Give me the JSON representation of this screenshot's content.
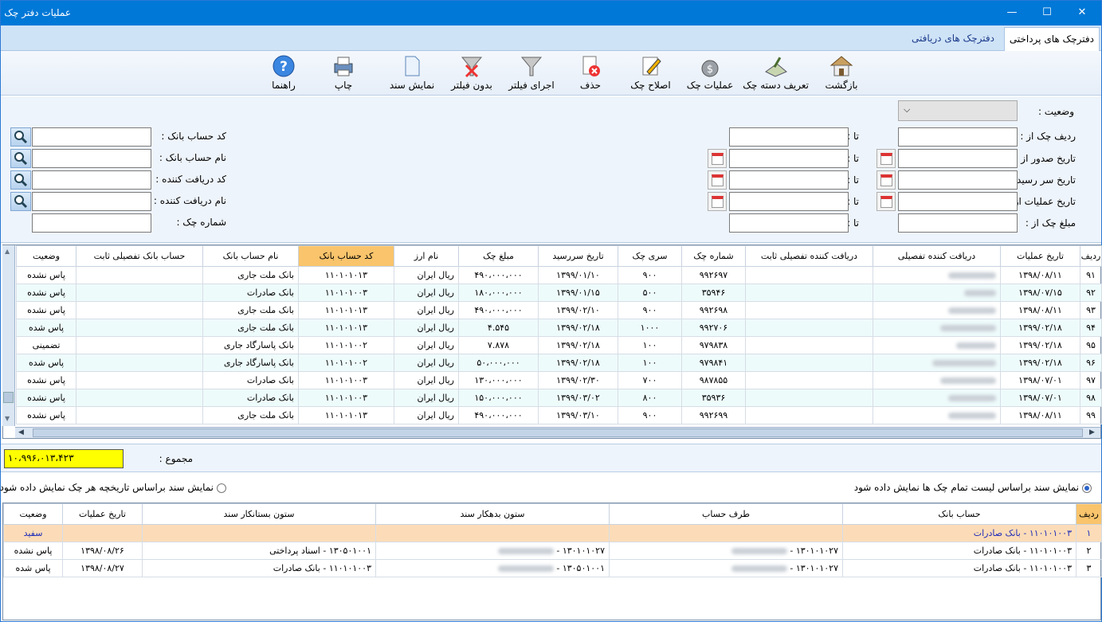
{
  "window": {
    "title": "عملیات دفتر چک",
    "minimize": "—",
    "maximize": "☐",
    "close": "✕"
  },
  "tabs": [
    {
      "label": "دفترچک های پرداختی",
      "active": true
    },
    {
      "label": "دفترچک های دریافتی",
      "active": false
    }
  ],
  "toolbar": [
    {
      "label": "بازگشت",
      "icon": "home-icon"
    },
    {
      "label": "تعریف دسته چک",
      "icon": "checkbook-icon"
    },
    {
      "label": "عملیات چک",
      "icon": "money-bag-icon"
    },
    {
      "label": "اصلاح چک",
      "icon": "edit-icon"
    },
    {
      "label": "حذف",
      "icon": "delete-icon"
    },
    {
      "label": "اجرای فیلتر",
      "icon": "filter-icon"
    },
    {
      "label": "بدون فیلتر",
      "icon": "clear-filter-icon"
    },
    {
      "label": "نمایش سند",
      "icon": "document-icon"
    },
    {
      "label": "چاپ",
      "icon": "printer-icon"
    },
    {
      "label": "راهنما",
      "icon": "help-icon"
    }
  ],
  "filters": {
    "status_label": "وضعیت :",
    "check_row_from": "ردیف چک از :",
    "issue_date_from": "تاریخ صدور از :",
    "due_date_from": "تاریخ سر رسید از :",
    "op_date_from": "تاریخ عملیات از :",
    "amount_from": "مبلغ چک از :",
    "to": "تا :",
    "bank_account_code": "کد حساب بانک :",
    "bank_account_name": "نام حساب بانک :",
    "receiver_code": "کد دریافت کننده :",
    "receiver_name": "نام دریافت کننده :",
    "check_number": "شماره چک :"
  },
  "grid": {
    "columns": [
      "ردیف",
      "تاریخ عملیات",
      "دریافت کننده تفصیلی",
      "دریافت کننده تفصیلی ثابت",
      "شماره چک",
      "سری چک",
      "تاریخ سررسید",
      "مبلغ چک",
      "نام ارز",
      "کد حساب بانک",
      "نام حساب بانک",
      "حساب بانک تفصیلی ثابت",
      "وضعیت"
    ],
    "rows": [
      {
        "row": "۹۱",
        "op_date": "۱۳۹۸/۰۸/۱۱",
        "check_no": "۹۹۲۶۹۷",
        "series": "۹۰۰",
        "due": "۱۳۹۹/۰۱/۱۰",
        "amount": "۴۹۰،۰۰۰،۰۰۰",
        "currency": "ریال ایران",
        "bank_code": "۱۱۰۱۰۱۰۱۳",
        "bank_name": "بانک ملت جاری",
        "status": "پاس نشده"
      },
      {
        "row": "۹۲",
        "op_date": "۱۳۹۸/۰۷/۱۵",
        "check_no": "۳۵۹۴۶",
        "series": "۵۰۰",
        "due": "۱۳۹۹/۰۱/۱۵",
        "amount": "۱۸۰،۰۰۰،۰۰۰",
        "currency": "ریال ایران",
        "bank_code": "۱۱۰۱۰۱۰۰۳",
        "bank_name": "بانک صادرات",
        "status": "پاس نشده"
      },
      {
        "row": "۹۳",
        "op_date": "۱۳۹۸/۰۸/۱۱",
        "check_no": "۹۹۲۶۹۸",
        "series": "۹۰۰",
        "due": "۱۳۹۹/۰۲/۱۰",
        "amount": "۴۹۰،۰۰۰،۰۰۰",
        "currency": "ریال ایران",
        "bank_code": "۱۱۰۱۰۱۰۱۳",
        "bank_name": "بانک ملت جاری",
        "status": "پاس نشده"
      },
      {
        "row": "۹۴",
        "op_date": "۱۳۹۹/۰۲/۱۸",
        "check_no": "۹۹۲۷۰۶",
        "series": "۱۰۰۰",
        "due": "۱۳۹۹/۰۲/۱۸",
        "amount": "۴.۵۴۵",
        "currency": "ریال ایران",
        "bank_code": "۱۱۰۱۰۱۰۱۳",
        "bank_name": "بانک ملت جاری",
        "status": "پاس شده"
      },
      {
        "row": "۹۵",
        "op_date": "۱۳۹۹/۰۲/۱۸",
        "check_no": "۹۷۹۸۳۸",
        "series": "۱۰۰",
        "due": "۱۳۹۹/۰۲/۱۸",
        "amount": "۷.۸۷۸",
        "currency": "ریال ایران",
        "bank_code": "۱۱۰۱۰۱۰۰۲",
        "bank_name": "بانک پاسارگاد جاری",
        "status": "تضمینی"
      },
      {
        "row": "۹۶",
        "op_date": "۱۳۹۹/۰۲/۱۸",
        "check_no": "۹۷۹۸۴۱",
        "series": "۱۰۰",
        "due": "۱۳۹۹/۰۲/۱۸",
        "amount": "۵۰،۰۰۰،۰۰۰",
        "currency": "ریال ایران",
        "bank_code": "۱۱۰۱۰۱۰۰۲",
        "bank_name": "بانک پاسارگاد جاری",
        "status": "پاس شده"
      },
      {
        "row": "۹۷",
        "op_date": "۱۳۹۸/۰۷/۰۱",
        "check_no": "۹۸۷۸۵۵",
        "series": "۷۰۰",
        "due": "۱۳۹۹/۰۲/۳۰",
        "amount": "۱۳۰،۰۰۰،۰۰۰",
        "currency": "ریال ایران",
        "bank_code": "۱۱۰۱۰۱۰۰۳",
        "bank_name": "بانک صادرات",
        "status": "پاس نشده"
      },
      {
        "row": "۹۸",
        "op_date": "۱۳۹۸/۰۷/۰۱",
        "check_no": "۳۵۹۳۶",
        "series": "۸۰۰",
        "due": "۱۳۹۹/۰۳/۰۲",
        "amount": "۱۵۰،۰۰۰،۰۰۰",
        "currency": "ریال ایران",
        "bank_code": "۱۱۰۱۰۱۰۰۳",
        "bank_name": "بانک صادرات",
        "status": "پاس نشده"
      },
      {
        "row": "۹۹",
        "op_date": "۱۳۹۸/۰۸/۱۱",
        "check_no": "۹۹۲۶۹۹",
        "series": "۹۰۰",
        "due": "۱۳۹۹/۰۳/۱۰",
        "amount": "۴۹۰،۰۰۰،۰۰۰",
        "currency": "ریال ایران",
        "bank_code": "۱۱۰۱۰۱۰۱۳",
        "bank_name": "بانک ملت جاری",
        "status": "پاس نشده"
      }
    ]
  },
  "summary": {
    "label": "مجموع :",
    "value": "۱۰،۹۹۶،۰۱۳،۴۲۳"
  },
  "options": {
    "opt1": "نمایش سند براساس لیست تمام چک ها نمایش داده شود",
    "opt2": "نمایش سند براساس تاریخچه هر چک نمایش داده شود"
  },
  "grid2": {
    "columns": [
      "ردیف",
      "حساب بانک",
      "طرف حساب",
      "ستون بدهکار سند",
      "ستون بستانکار سند",
      "تاریخ عملیات",
      "وضعیت"
    ],
    "rows": [
      {
        "row": "۱",
        "bank": "۱۱۰۱۰۱۰۰۳ - بانک صادرات",
        "party": "",
        "debit": "",
        "credit": "",
        "date": "",
        "status": "سفید"
      },
      {
        "row": "۲",
        "bank": "۱۱۰۱۰۱۰۰۳ - بانک صادرات",
        "party": "۱۳۰۱۰۱۰۲۷ - ",
        "debit": "۱۳۰۱۰۱۰۲۷ - ",
        "credit": "۱۳۰۵۰۱۰۰۱ - اسناد پرداختی",
        "date": "۱۳۹۸/۰۸/۲۶",
        "status": "پاس نشده"
      },
      {
        "row": "۳",
        "bank": "۱۱۰۱۰۱۰۰۳ - بانک صادرات",
        "party": "۱۳۰۱۰۱۰۲۷ - ",
        "debit": "۱۳۰۵۰۱۰۰۱ - ",
        "credit": "۱۱۰۱۰۱۰۰۳ - بانک صادرات",
        "date": "۱۳۹۸/۰۸/۲۷",
        "status": "پاس شده"
      }
    ]
  }
}
